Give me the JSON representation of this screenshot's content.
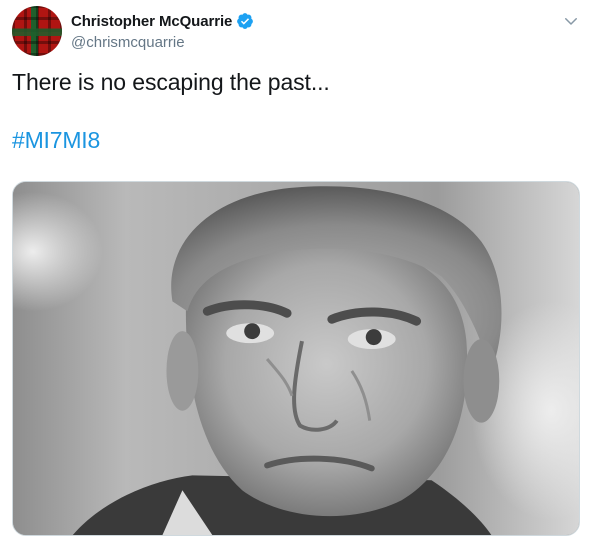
{
  "tweet": {
    "display_name": "Christopher McQuarrie",
    "handle": "@chrismcquarrie",
    "text": "There is no escaping the past...",
    "hashtag": "#MI7MI8"
  },
  "icons": {
    "verified": "verified-badge-icon",
    "more": "chevron-down-icon",
    "avatar": "tartan-avatar"
  },
  "colors": {
    "text": "#14171a",
    "secondary": "#657786",
    "link": "#1b95e0",
    "verified": "#1da1f2"
  },
  "media": {
    "type": "black-and-white photo",
    "subject": "close-up portrait of a gray-haired man looking upward"
  }
}
